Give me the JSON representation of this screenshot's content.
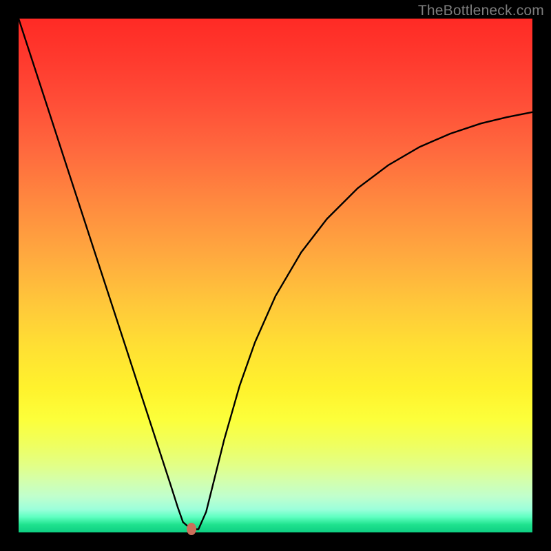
{
  "watermark": "TheBottleneck.com",
  "marker": {
    "x_pct": 33.6,
    "y_pct": 99.3,
    "color": "#cb6f5a"
  },
  "chart_data": {
    "type": "line",
    "title": "",
    "xlabel": "",
    "ylabel": "",
    "xlim": [
      0,
      100
    ],
    "ylim": [
      0,
      100
    ],
    "grid": false,
    "legend": false,
    "background": "rainbow-vertical-gradient",
    "annotations": [
      {
        "kind": "marker",
        "x": 33.6,
        "y": 0.7,
        "color": "#cb6f5a"
      }
    ],
    "series": [
      {
        "name": "curve",
        "color": "#000000",
        "x": [
          0,
          3,
          6,
          9,
          12,
          15,
          18,
          21,
          24,
          27,
          29.5,
          31.0,
          32.0,
          33.6,
          35.0,
          36.5,
          38.0,
          40.0,
          43.0,
          46.0,
          50.0,
          55.0,
          60.0,
          66.0,
          72.0,
          78.0,
          84.0,
          90.0,
          95.0,
          100.0
        ],
        "y": [
          100,
          90.8,
          81.6,
          72.4,
          63.2,
          54.0,
          44.8,
          35.6,
          26.4,
          17.2,
          9.5,
          4.8,
          2.0,
          0.6,
          0.6,
          4.0,
          10.0,
          18.0,
          28.5,
          37.0,
          46.0,
          54.5,
          61.0,
          67.0,
          71.5,
          75.0,
          77.6,
          79.6,
          80.8,
          81.8
        ]
      }
    ]
  }
}
